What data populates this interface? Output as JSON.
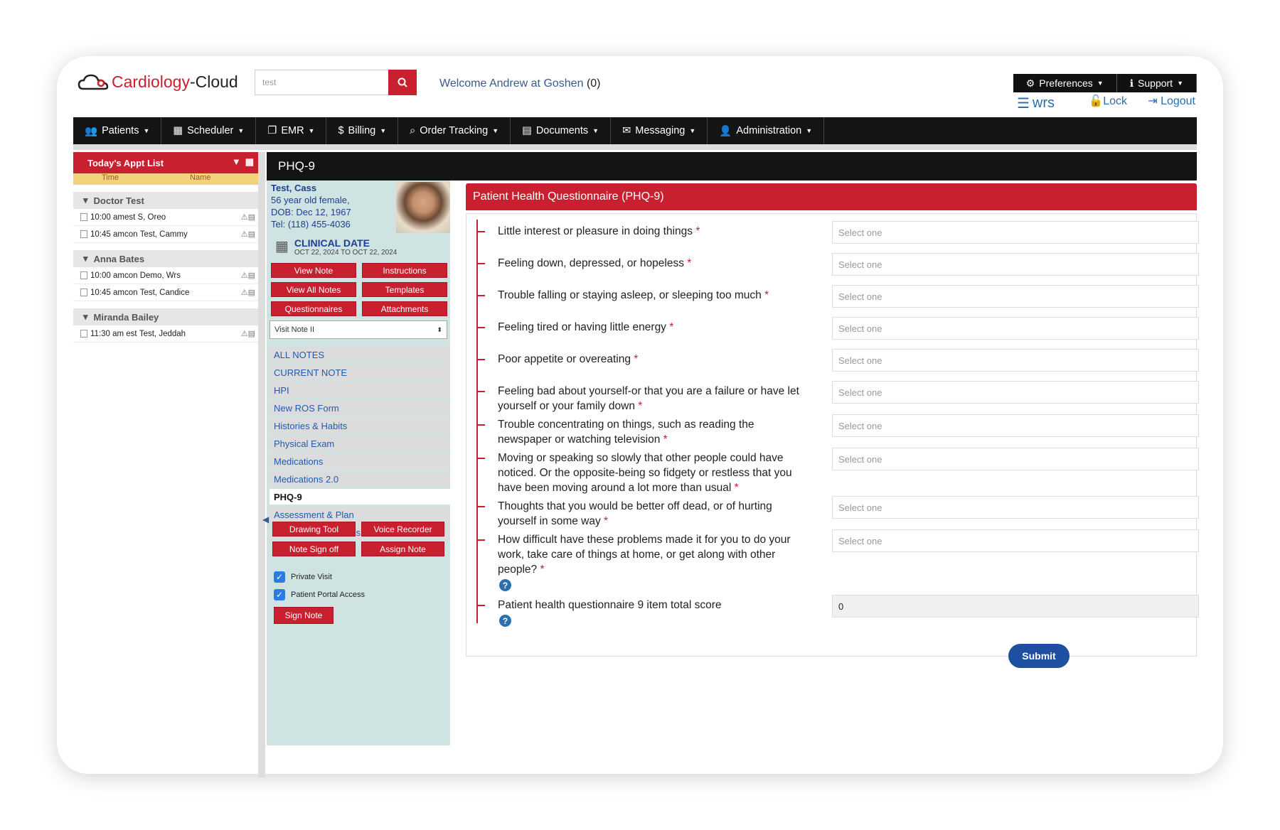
{
  "brand": {
    "part1": "Cardiology",
    "part2": "-Cloud"
  },
  "search": {
    "value": "test"
  },
  "welcome": {
    "text": "Welcome Andrew at Goshen",
    "count": "(0)"
  },
  "topbar": {
    "preferences": "Preferences",
    "support": "Support",
    "wrs": "wrs",
    "lock": "Lock",
    "logout": "Logout"
  },
  "nav": [
    "Patients",
    "Scheduler",
    "EMR",
    "Billing",
    "Order Tracking",
    "Documents",
    "Messaging",
    "Administration"
  ],
  "appt": {
    "header": "Today's Appt List",
    "col_time": "Time",
    "col_name": "Name",
    "groups": [
      {
        "doctor": "Doctor Test",
        "rows": [
          {
            "time": "10:00 amest",
            "name": "S, Oreo"
          },
          {
            "time": "10:45 amcon",
            "name": "Test, Cammy"
          }
        ]
      },
      {
        "doctor": "Anna Bates",
        "rows": [
          {
            "time": "10:00 amcon",
            "name": "Demo, Wrs"
          },
          {
            "time": "10:45 amcon",
            "name": "Test, Candice"
          }
        ]
      },
      {
        "doctor": "Miranda Bailey",
        "rows": [
          {
            "time": "11:30 am est",
            "name": "Test, Jeddah"
          }
        ]
      }
    ]
  },
  "page_title": "PHQ-9",
  "patient": {
    "name": "Test, Cass",
    "line1": "56 year old female,",
    "dob": "DOB: Dec 12, 1967",
    "tel": "Tel: (118) 455-4036",
    "clinical_label": "CLINICAL DATE",
    "clinical_range": "OCT 22, 2024 TO OCT 22, 2024"
  },
  "note_buttons": [
    "View Note",
    "Instructions",
    "View All Notes",
    "Templates",
    "Questionnaires",
    "Attachments"
  ],
  "visit_select": "Visit Note II",
  "note_sections": [
    "ALL NOTES",
    "CURRENT NOTE",
    "HPI",
    "New ROS Form",
    "Histories & Habits",
    "Physical Exam",
    "Medications",
    "Medications 2.0",
    "PHQ-9",
    "Assessment & Plan",
    "Orders & Procedures"
  ],
  "tool_buttons": [
    "Drawing Tool",
    "Voice Recorder",
    "Note Sign off",
    "Assign Note"
  ],
  "checks": [
    "Private Visit",
    "Patient Portal Access"
  ],
  "sign_button": "Sign Note",
  "form": {
    "title": "Patient Health Questionnaire (PHQ-9)",
    "placeholder": "Select one",
    "questions": [
      "Little interest or pleasure in doing things",
      "Feeling down, depressed, or hopeless",
      "Trouble falling or staying asleep, or sleeping too much",
      "Feeling tired or having little energy",
      "Poor appetite or overeating",
      "Feeling bad about yourself-or that you are a failure or have let yourself or your family down",
      "Trouble concentrating on things, such as reading the newspaper or watching television",
      "Moving or speaking so slowly that other people could have noticed. Or the opposite-being so fidgety or restless that you have been moving around a lot more than usual",
      "Thoughts that you would be better off dead, or of hurting yourself in some way",
      "How difficult have these problems made it for you to do your work, take care of things at home, or get along with other people?"
    ],
    "total_label": "Patient health questionnaire 9 item total score",
    "total_value": "0",
    "submit": "Submit"
  }
}
